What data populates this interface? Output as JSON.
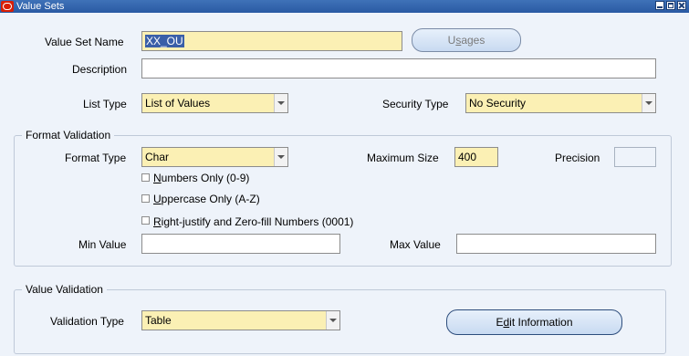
{
  "window": {
    "title": "Value Sets"
  },
  "value_set_name": {
    "label": "Value Set Name",
    "value": "XX_OU"
  },
  "usages_button": {
    "label": "Usages",
    "mnemonic_pre": "U",
    "mnemonic": "s",
    "mnemonic_post": "ages"
  },
  "description": {
    "label": "Description",
    "value": ""
  },
  "list_type": {
    "label": "List Type",
    "value": "List of Values"
  },
  "security_type": {
    "label": "Security Type",
    "value": "No Security"
  },
  "format_validation": {
    "title": "Format Validation",
    "format_type": {
      "label": "Format Type",
      "value": "Char"
    },
    "maximum_size": {
      "label": "Maximum Size",
      "value": "400"
    },
    "precision": {
      "label": "Precision",
      "value": ""
    },
    "checkboxes": [
      {
        "mnemonic": "N",
        "rest": "umbers Only (0-9)",
        "checked": false
      },
      {
        "mnemonic": "U",
        "rest": "ppercase Only (A-Z)",
        "checked": false
      },
      {
        "mnemonic": "R",
        "rest": "ight-justify and Zero-fill Numbers (0001)",
        "checked": false
      }
    ],
    "min_value": {
      "label": "Min Value",
      "value": ""
    },
    "max_value": {
      "label": "Max Value",
      "value": ""
    }
  },
  "value_validation": {
    "title": "Value Validation",
    "validation_type": {
      "label": "Validation Type",
      "value": "Table"
    },
    "edit_button": {
      "mnemonic_pre": "E",
      "mnemonic": "d",
      "mnemonic_post": "it Information"
    }
  }
}
